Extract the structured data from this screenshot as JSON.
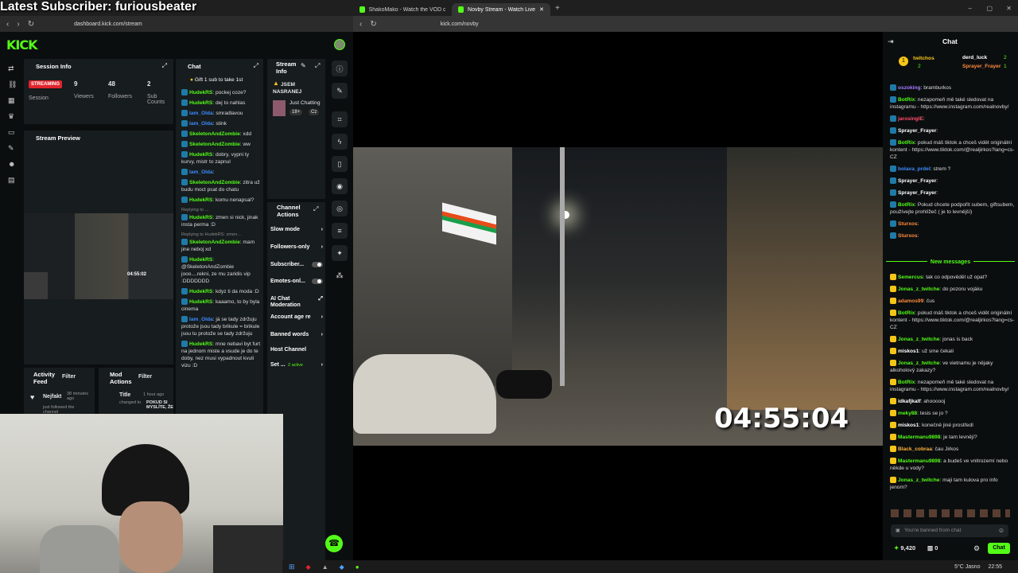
{
  "overlay": {
    "title": "Latest Subscriber: furiousbeater"
  },
  "left_browser": {
    "tabs": [
      {
        "label": "ShakoMako - Watch the VOD on Kick"
      },
      {
        "label": "Novby Stream - Watch Live o..."
      }
    ],
    "url": "dashboard.kick.com/stream"
  },
  "right_browser": {
    "url": "kick.com/novby"
  },
  "dashboard": {
    "logo": "KICK",
    "session": {
      "title": "Session Info",
      "status": "STREAMING",
      "session_label": "Session",
      "viewers": "9",
      "viewers_label": "Viewers",
      "followers": "48",
      "followers_label": "Followers",
      "subs": "2",
      "subs_label": "Sub Counts"
    },
    "preview_title": "Stream Preview",
    "preview_time": "04:55:02",
    "activity": {
      "title": "Activity Feed",
      "filter": "Filter",
      "item_user": "Nejfakt",
      "item_time": "38 minutes ago",
      "item_text": "just followed the channel"
    },
    "mod": {
      "title": "Mod Actions",
      "filter": "Filter",
      "item_label": "Title",
      "item_time": "1 hour ago",
      "item_text1": "changed to",
      "item_text2": "POKUD SI MYSLÍTE, ŽE"
    },
    "chat": {
      "title": "Chat",
      "gift": "Gift 1 sub to take 1st",
      "messages": [
        {
          "user": "HudekRS",
          "text": ": pockej coze?",
          "color": "#53fc18"
        },
        {
          "user": "HudekRS",
          "text": ": dej to nahlas",
          "color": "#53fc18"
        },
        {
          "user": "Iam_Olda",
          "text": ": smradlavou",
          "color": "#3d8bfd"
        },
        {
          "user": "Iam_Olda",
          "text": ": stink",
          "color": "#3d8bfd"
        },
        {
          "user": "SkeletonAndZombie",
          "text": ": xdd",
          "color": "#53fc18"
        },
        {
          "user": "SkeletonAndZombie",
          "text": ": ww",
          "color": "#53fc18"
        },
        {
          "user": "HudekRS",
          "text": ": dobry, vypni ty kurvy, mistr to zapnul",
          "color": "#53fc18"
        },
        {
          "user": "Iam_Olda",
          "text": ":",
          "color": "#3d8bfd"
        },
        {
          "user": "SkeletonAndZombie",
          "text": ": zitra už budu moct psat do chatu",
          "color": "#53fc18"
        },
        {
          "user": "HudekRS",
          "text": ": komu nenapsal?",
          "color": "#53fc18"
        },
        {
          "reply": "Replying to ...",
          "user": "HudekRS",
          "text": ": zmen si nick, jinak insta perma :D",
          "color": "#53fc18"
        },
        {
          "reply": "Replying to HudekRS: zmen...",
          "user": "SkeletonAndZombie",
          "text": ": mam jine neboj xd",
          "color": "#53fc18"
        },
        {
          "user": "HudekRS",
          "text": ": @SkeletonAndZombie jooo....rekni, ze mu zaridis vip :DDDDDDD",
          "color": "#53fc18"
        },
        {
          "user": "HudekRS",
          "text": ": kdyz ti da moda :D",
          "color": "#53fc18"
        },
        {
          "user": "HudekRS",
          "text": ": kaaamo, to by byla cinema",
          "color": "#53fc18"
        },
        {
          "user": "Iam_Olda",
          "text": ": já se tady zdržuju protože jsou tady brikule = brikule jsou tu protože se tady zdržuju",
          "color": "#3d8bfd"
        },
        {
          "user": "HudekRS",
          "text": ": mne nebavi byt furt na jednom miste a vsude je do te doby, nez musi vypadnout kvuli vizu :D",
          "color": "#53fc18"
        }
      ]
    },
    "stream_info": {
      "title": "Stream Info",
      "stream_title": "JSEM NASRANEJ",
      "category": "Just Chatting",
      "tags": [
        "18+",
        "Cz"
      ]
    },
    "channel_actions": {
      "title": "Channel Actions",
      "rows": [
        {
          "label": "Slow mode",
          "kind": "arrow"
        },
        {
          "label": "Followers-only",
          "kind": "arrow"
        },
        {
          "label": "Subscriber...",
          "kind": "toggle"
        },
        {
          "label": "Emotes-onl...",
          "kind": "toggle"
        },
        {
          "label": "AI Chat Moderation",
          "kind": "ext"
        },
        {
          "label": "Account age re",
          "kind": "arrow"
        },
        {
          "label": "Banned words",
          "kind": "arrow"
        },
        {
          "label": "Host Channel",
          "kind": "none"
        },
        {
          "label": "Set ...",
          "extra": "2 active",
          "kind": "arrow"
        }
      ]
    }
  },
  "video": {
    "timer": "04:55:04"
  },
  "right_chat": {
    "title": "Chat",
    "leaderboard": [
      {
        "name": "twitchos",
        "count": "2"
      },
      {
        "name": "derd_luck",
        "count": "2"
      },
      {
        "name": "Sprayer_Frayer",
        "count": "1"
      }
    ],
    "messages": [
      {
        "user": "oszoking",
        "text": ": bramburkos",
        "color": "#a67cff"
      },
      {
        "user": "BotRix",
        "text": ": nezapomeň mě také sledovat na instagramu - https://www.instagram.com/realnovby/",
        "color": "#53fc18"
      },
      {
        "user": "jarosinglE",
        "text": ":",
        "color": "#ff4f6a"
      },
      {
        "user": "Sprayer_Frayer",
        "text": ":",
        "color": "#ffffff"
      },
      {
        "user": "BotRix",
        "text": ": pokud máš tiktok a chceš vidět originální kontent - https://www.tiktok.com/@realjirkos?lang=cs-CZ",
        "color": "#53fc18"
      },
      {
        "user": "bolava_prdel",
        "text": ": strem ?",
        "color": "#3d8bfd"
      },
      {
        "user": "Sprayer_Frayer",
        "text": ":",
        "color": "#ffffff"
      },
      {
        "user": "Sprayer_Frayer",
        "text": ":",
        "color": "#ffffff"
      },
      {
        "user": "BotRix",
        "text": ": Pokud chcete podpořit subem, giftsubem, používejte prohlížeč ( je to levnější)",
        "color": "#53fc18"
      },
      {
        "user": "Sturxos",
        "text": ":",
        "color": "#ff8a3d"
      },
      {
        "user": "Sturxos",
        "text": ":",
        "color": "#ff8a3d"
      }
    ],
    "new_messages": "New messages",
    "messages2": [
      {
        "user": "Semercus",
        "text": ": tak co odpověděl už opat?",
        "color": "#53fc18"
      },
      {
        "user": "Jonas_z_twitche",
        "text": ": do pozoru vojáku",
        "color": "#53fc18"
      },
      {
        "user": "adamos99",
        "text": ": čus",
        "color": "#ff8a3d"
      },
      {
        "user": "BotRix",
        "text": ": pokud máš tiktok a chceš vidět originální kontent - https://www.tiktok.com/@realjirkos?lang=cs-CZ",
        "color": "#53fc18"
      },
      {
        "user": "Jonas_z_twitche",
        "text": ": jonas is back",
        "color": "#53fc18"
      },
      {
        "user": "miskos1",
        "text": ": už sme čekali",
        "color": "#ffffff"
      },
      {
        "user": "Jonas_z_twitche",
        "text": ": ve vietnamu je nějaky alkoholový zakazy?",
        "color": "#53fc18"
      },
      {
        "user": "BotRix",
        "text": ": nezapomeň mě také sledovat na instagramu - https://www.instagram.com/realnovby/",
        "color": "#53fc18"
      },
      {
        "user": "idkafjkalf",
        "text": ": ahoooooj",
        "color": "#ffffff"
      },
      {
        "user": "meky88",
        "text": ": tesis se jo ?",
        "color": "#53fc18"
      },
      {
        "user": "miskos1",
        "text": ": konečně jiné prostředí",
        "color": "#ffffff"
      },
      {
        "user": "Mastermanu9898",
        "text": ": je tam levnějí?",
        "color": "#53fc18"
      },
      {
        "user": "Black_cobraa",
        "text": ": čau Jirkos",
        "color": "#ffb13b"
      },
      {
        "user": "Mastermanu9898",
        "text": ": a budeš ve vnitrozemí nebo někde u vody?",
        "color": "#53fc18"
      },
      {
        "user": "Jonas_z_twitche",
        "text": ": maji tam kulova pro info jenom?",
        "color": "#53fc18"
      }
    ],
    "banned_placeholder": "You're banned from chat",
    "points": "9,420",
    "bits": "0",
    "chat_button": "Chat"
  },
  "taskbar": {
    "weather": "5°C  Jasno",
    "time": "22:55"
  }
}
